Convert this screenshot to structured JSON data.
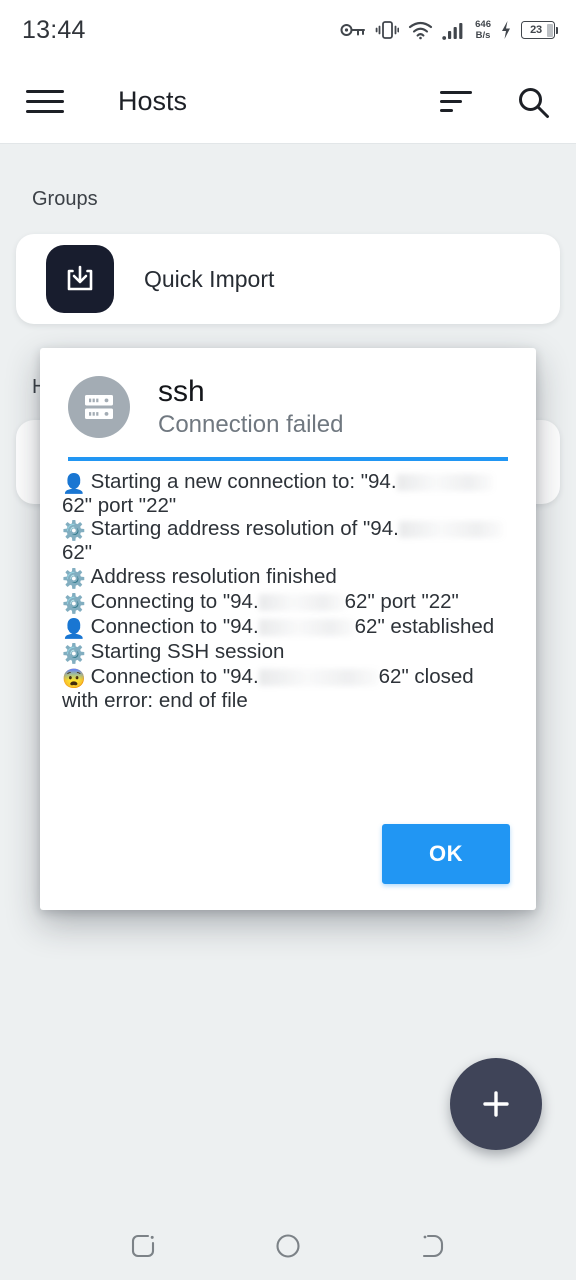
{
  "status_bar": {
    "clock": "13:44",
    "icons": [
      "vpn-key-icon",
      "vibrate-icon",
      "wifi-icon",
      "signal-icon"
    ],
    "network_speed_value": "646",
    "network_speed_unit": "B/s",
    "charging_icon": "charging-bolt-icon",
    "battery_level": "23"
  },
  "app_bar": {
    "menu_icon": "hamburger-menu-icon",
    "title": "Hosts",
    "sort_icon": "sort-icon",
    "search_icon": "search-icon"
  },
  "sections": {
    "groups_label": "Groups",
    "hosts_label": "Hosts"
  },
  "quick_import": {
    "icon": "download-import-icon",
    "label": "Quick Import"
  },
  "fab": {
    "icon": "plus-icon",
    "label": "+"
  },
  "dialog": {
    "avatar_icon": "server-rack-icon",
    "title": "ssh",
    "subtitle": "Connection failed",
    "accent_color": "#2196f3",
    "log_lines": [
      {
        "emoji": "👤",
        "emoji_name": "bust-in-silhouette-emoji",
        "prefix": "Starting a new connection to: \"94.",
        "redacted": true,
        "suffix": "62\" port \"22\""
      },
      {
        "emoji": "⚙️",
        "emoji_name": "gear-emoji",
        "prefix": "Starting address resolution of \"94.",
        "redacted": true,
        "suffix": "62\""
      },
      {
        "emoji": "⚙️",
        "emoji_name": "gear-emoji",
        "prefix": "Address resolution finished",
        "redacted": false,
        "suffix": ""
      },
      {
        "emoji": "⚙️",
        "emoji_name": "gear-emoji",
        "prefix": "Connecting to \"94.",
        "redacted": true,
        "suffix": "62\" port \"22\""
      },
      {
        "emoji": "👤",
        "emoji_name": "bust-in-silhouette-emoji",
        "prefix": "Connection to \"94.",
        "redacted": true,
        "suffix": "62\" established"
      },
      {
        "emoji": "⚙️",
        "emoji_name": "gear-emoji",
        "prefix": "Starting SSH session",
        "redacted": false,
        "suffix": ""
      },
      {
        "emoji": "😨",
        "emoji_name": "fearful-face-emoji",
        "prefix": "Connection to \"94.",
        "redacted": true,
        "suffix": "62\" closed with error: end of file"
      }
    ],
    "ok_label": "OK"
  },
  "nav_bar": {
    "recents_icon": "recents-icon",
    "home_icon": "home-icon",
    "back_icon": "back-icon"
  }
}
